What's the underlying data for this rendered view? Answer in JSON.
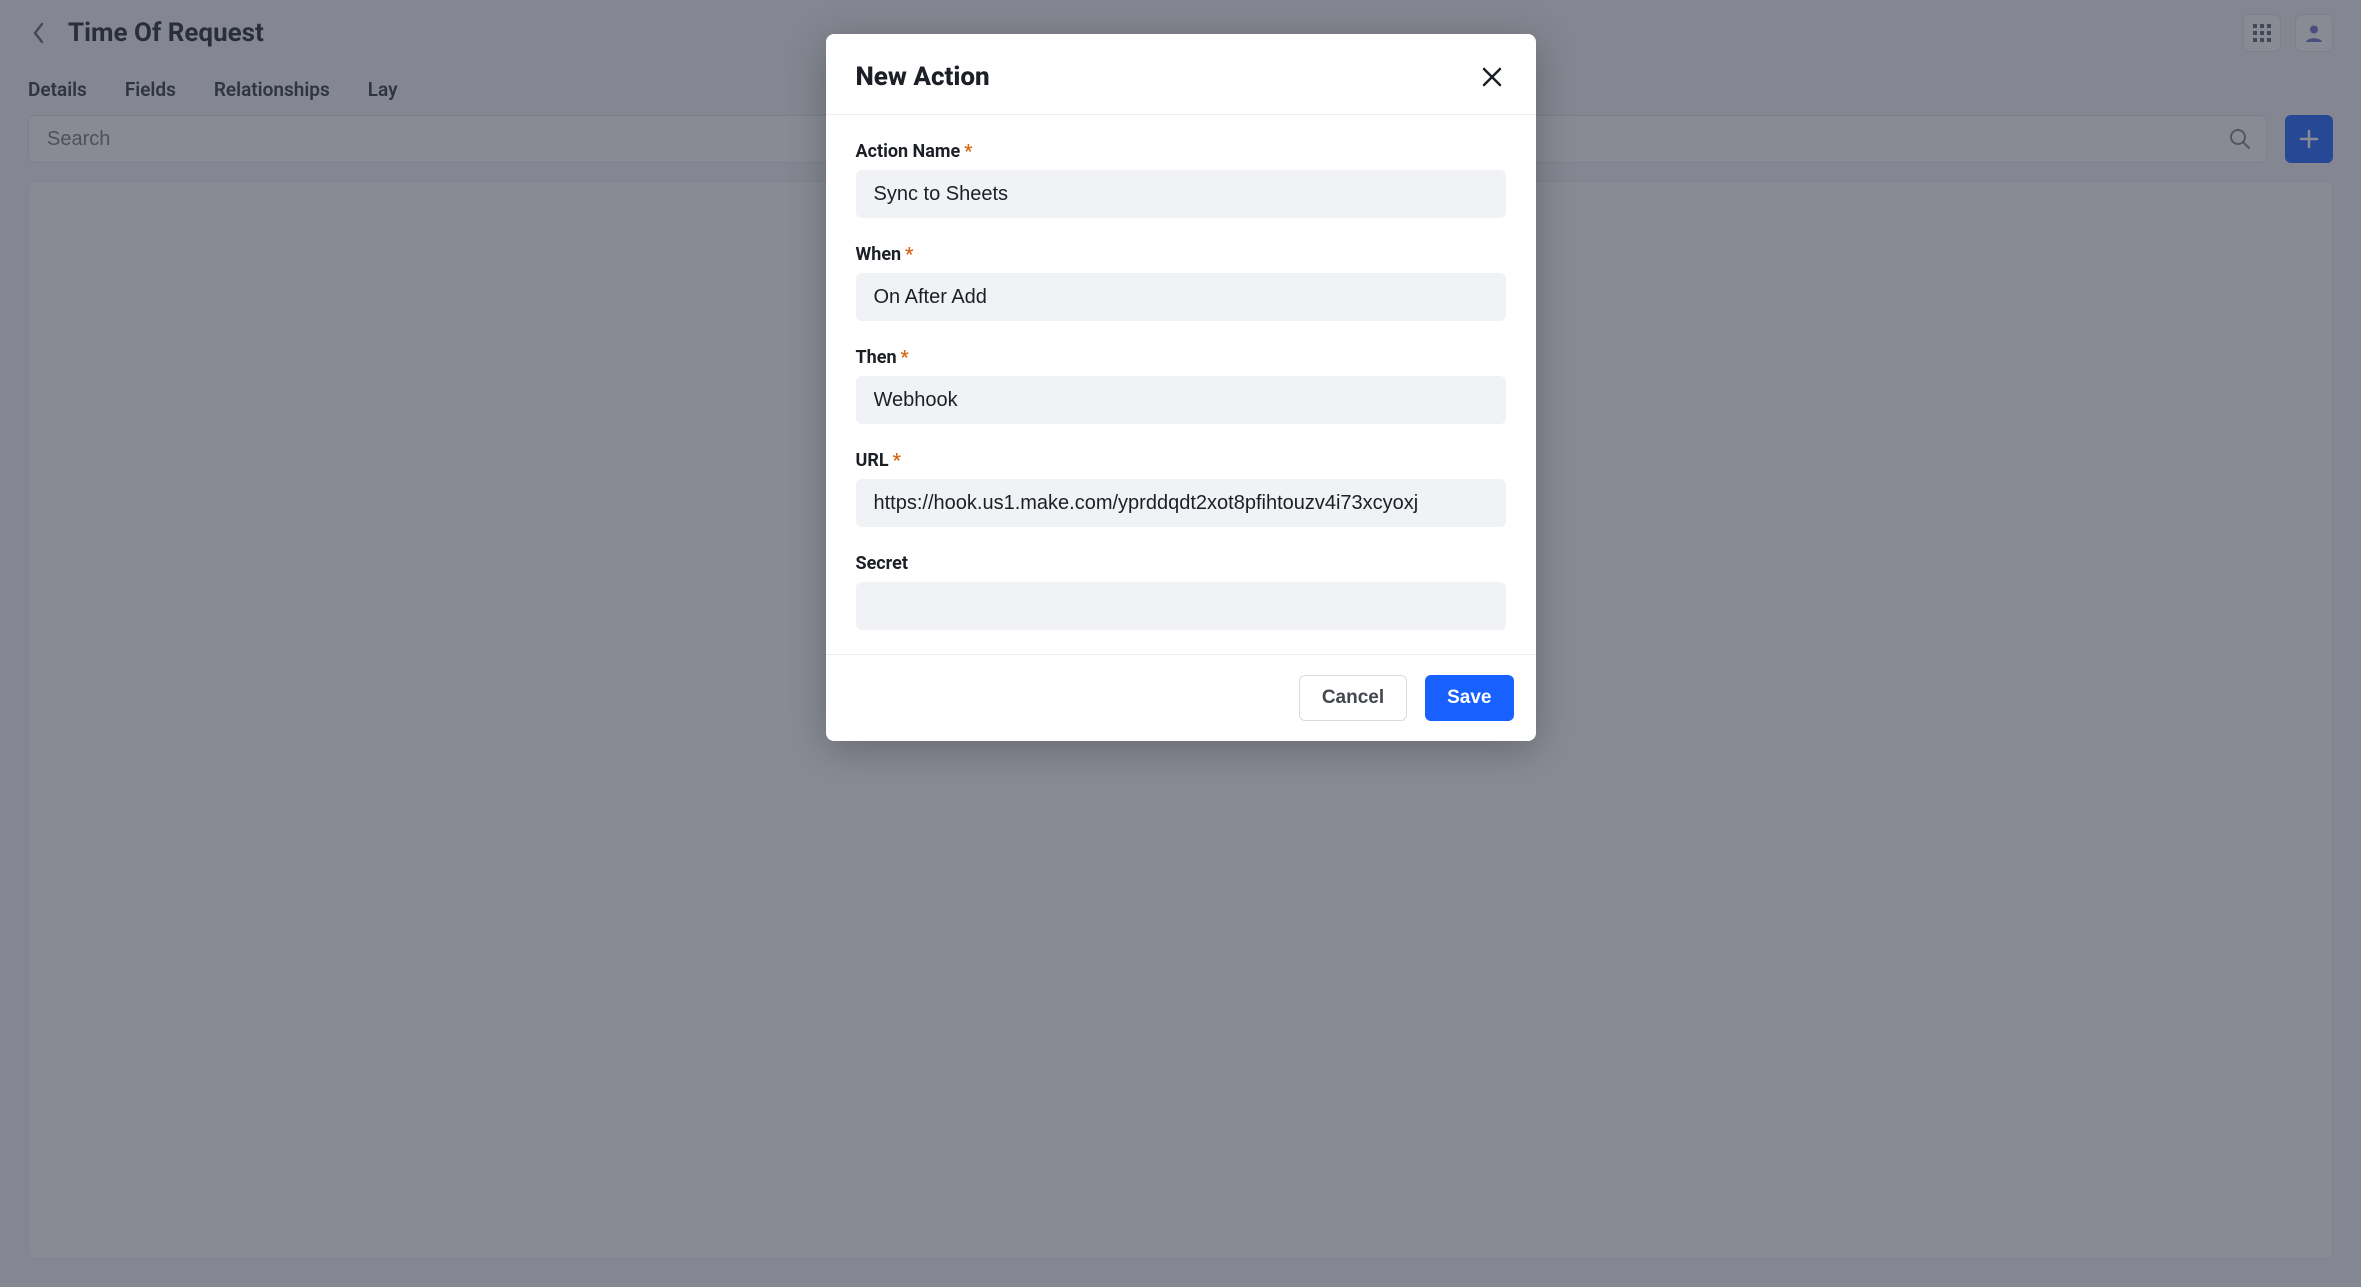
{
  "page": {
    "title": "Time Of Request",
    "tabs": [
      "Details",
      "Fields",
      "Relationships",
      "Lay"
    ],
    "search_placeholder": "Search"
  },
  "modal": {
    "title": "New Action",
    "fields": {
      "action_name": {
        "label": "Action Name",
        "value": "Sync to Sheets",
        "required": true
      },
      "when": {
        "label": "When",
        "value": "On After Add",
        "required": true
      },
      "then": {
        "label": "Then",
        "value": "Webhook",
        "required": true
      },
      "url": {
        "label": "URL",
        "value": "https://hook.us1.make.com/yprddqdt2xot8pfihtouzv4i73xcyoxj",
        "required": true
      },
      "secret": {
        "label": "Secret",
        "value": "",
        "required": false
      }
    },
    "buttons": {
      "cancel": "Cancel",
      "save": "Save"
    }
  }
}
